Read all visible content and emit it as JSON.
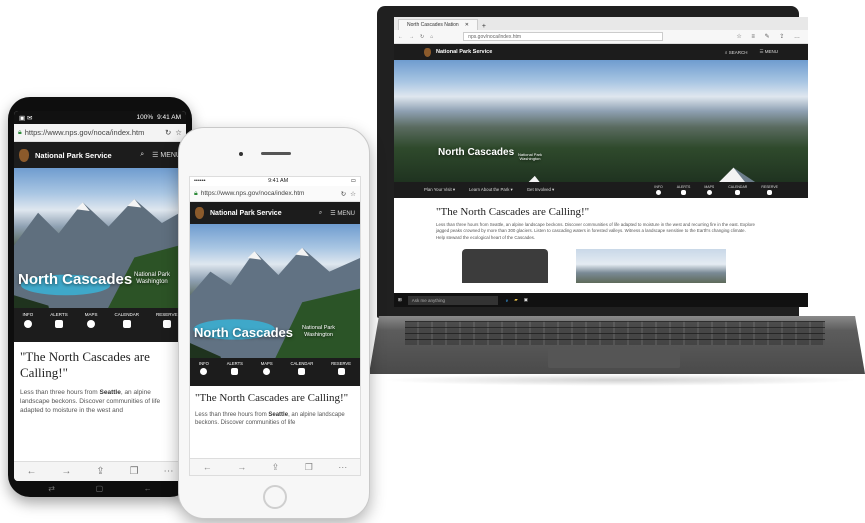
{
  "site": {
    "brand": "National Park Service",
    "park_name": "North Cascades",
    "park_sub": "National Park\nWashington",
    "menu": "MENU",
    "search": "SEARCH",
    "headline_mobile": "\"The North Cascades are Calling!\"",
    "headline_desktop": "\"The North Cascades are Calling!\"",
    "intro_prefix": "Less than three hours from ",
    "intro_bold": "Seattle",
    "intro_rest_android": ", an alpine landscape beckons. Discover communities of life adapted to moisture in the west and",
    "intro_rest_iphone": ", an alpine landscape beckons. Discover communities of life",
    "intro_desktop": "Less than three hours from Seattle, an alpine landscape beckons. Discover communities of life adapted to moisture in the west and recurring fire in the east. Explore jagged peaks crowned by more than 300 glaciers. Listen to cascading waters in forested valleys. Witness a landscape sensitive to the Earth's changing climate. Help steward the ecological heart of the Cascades.",
    "quick_links": [
      "INFO",
      "ALERTS",
      "MAPS",
      "CALENDAR",
      "RESERVE"
    ],
    "desktop_nav": [
      "Plan Your Visit ▾",
      "Learn About the Park ▾",
      "Get Involved ▾"
    ]
  },
  "android": {
    "time": "9:41 AM",
    "battery": "100%",
    "url": "https://www.nps.gov/noca/index.htm"
  },
  "iphone": {
    "carrier": "•••••• ",
    "time": "9:41 AM",
    "url": "https://www.nps.gov/noca/index.htm"
  },
  "laptop": {
    "tab_title": "North Cascades Nation",
    "address": "nps.gov/noca/index.htm",
    "taskbar_search": "Ask me anything"
  },
  "colors": {
    "header_bg": "#1c1c1c",
    "nps_brown": "#8b5a2b",
    "lake": "#3fa8c9"
  }
}
